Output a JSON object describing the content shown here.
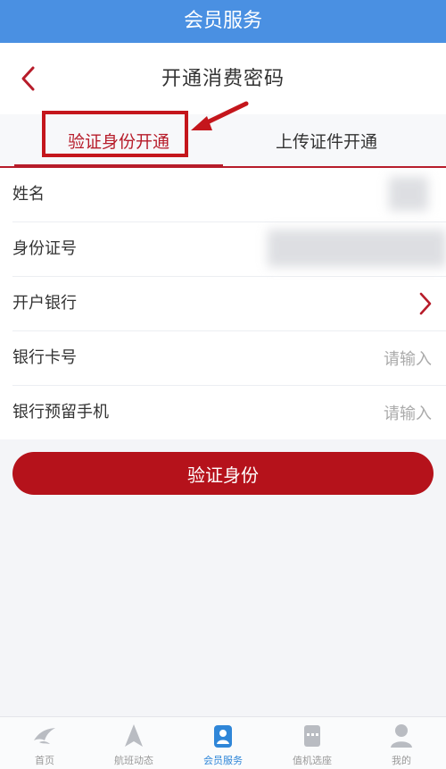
{
  "status_bar": {
    "title": "会员服务"
  },
  "header": {
    "title": "开通消费密码"
  },
  "tabs": [
    {
      "label": "验证身份开通",
      "active": true
    },
    {
      "label": "上传证件开通",
      "active": false
    }
  ],
  "form": {
    "fields": [
      {
        "label": "姓名",
        "placeholder": ""
      },
      {
        "label": "身份证号",
        "placeholder": ""
      },
      {
        "label": "开户银行",
        "placeholder": ""
      },
      {
        "label": "银行卡号",
        "placeholder": "请输入"
      },
      {
        "label": "银行预留手机",
        "placeholder": "请输入"
      }
    ]
  },
  "submit": {
    "label": "验证身份"
  },
  "bottom_nav": {
    "items": [
      {
        "label": "首页",
        "icon": "bird-logo-icon",
        "active": false
      },
      {
        "label": "航班动态",
        "icon": "plane-icon",
        "active": false
      },
      {
        "label": "会员服务",
        "icon": "member-card-icon",
        "active": true
      },
      {
        "label": "值机选座",
        "icon": "seat-icon",
        "active": false
      },
      {
        "label": "我的",
        "icon": "user-icon",
        "active": false
      }
    ]
  },
  "colors": {
    "topbar": "#4a90e2",
    "accent_red": "#b5121b",
    "highlight_red": "#c4161c",
    "nav_active": "#2f86d8"
  }
}
